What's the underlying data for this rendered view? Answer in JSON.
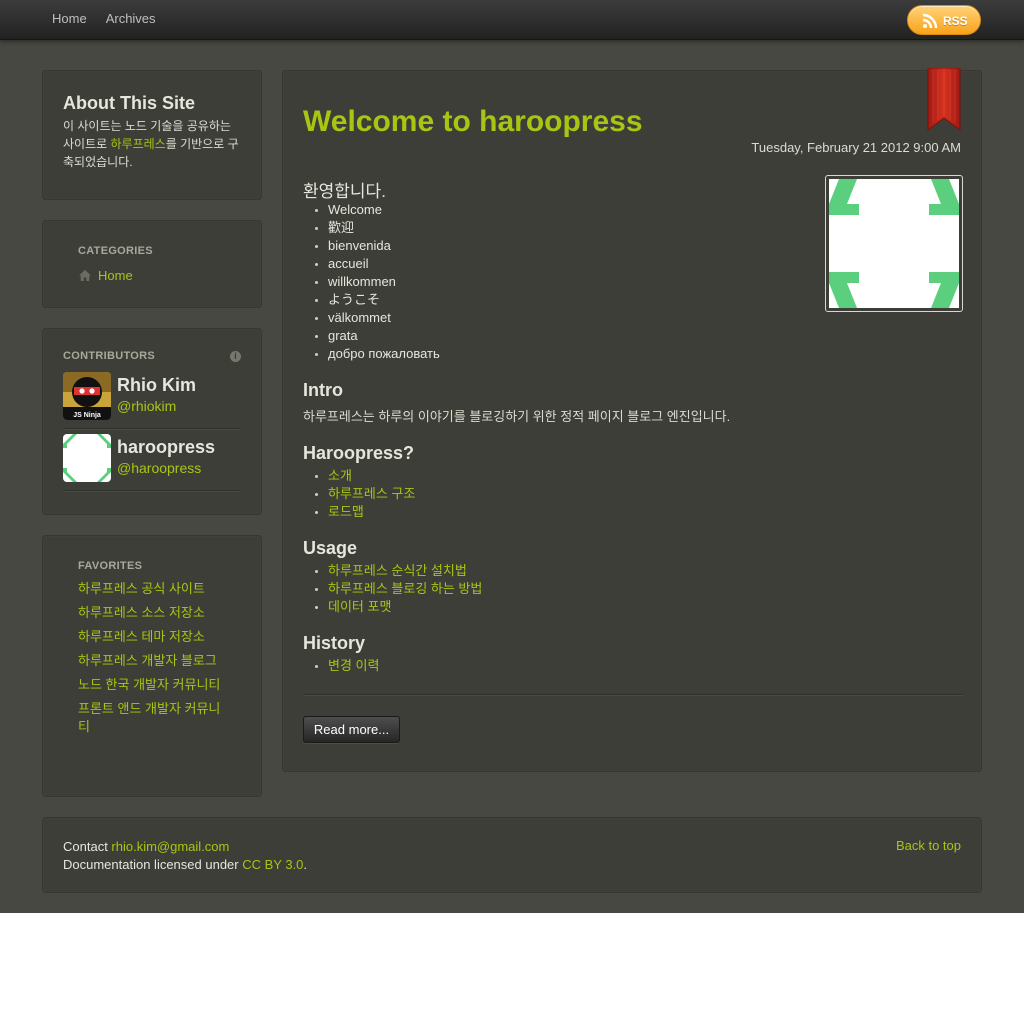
{
  "nav": {
    "home": "Home",
    "archives": "Archives",
    "rss": "RSS"
  },
  "about": {
    "title": "About This Site",
    "text_before": "이 사이트는 노드 기술을 공유하는 사이트로 ",
    "link": "하루프레스",
    "text_after": "를 기반으로 구축되었습니다."
  },
  "categories": {
    "title": "CATEGORIES",
    "items": [
      {
        "label": "Home",
        "icon": "home-icon"
      }
    ]
  },
  "contributors": {
    "title": "CONTRIBUTORS",
    "items": [
      {
        "name": "Rhio Kim",
        "handle": "@rhiokim",
        "avatar_caption": "JS Ninja"
      },
      {
        "name": "haroopress",
        "handle": "@haroopress"
      }
    ]
  },
  "favorites": {
    "title": "FAVORITES",
    "items": [
      "하루프레스 공식 사이트",
      "하루프레스 소스 저장소",
      "하루프레스 테마 저장소",
      "하루프레스 개발자 블로그",
      "노드 한국 개발자 커뮤니티",
      "프론트 앤드 개발자 커뮤니티"
    ]
  },
  "post": {
    "title": "Welcome to haroopress",
    "date": "Tuesday, February 21 2012 9:00 AM",
    "welcome_heading": "환영합니다.",
    "welcome_list": [
      "Welcome",
      "歡迎",
      "bienvenida",
      "accueil",
      "willkommen",
      "ようこそ",
      "välkommet",
      "grata",
      "добро пожаловать"
    ],
    "intro_heading": "Intro",
    "intro_text": "하루프레스는 하루의 이야기를 블로깅하기 위한 정적 페이지 블로그 엔진입니다.",
    "haroopress_heading": "Haroopress?",
    "haroopress_links": [
      "소개",
      "하루프레스 구조",
      "로드맵"
    ],
    "usage_heading": "Usage",
    "usage_links": [
      "하루프레스 순식간 설치법",
      "하루프레스 블로깅 하는 방법",
      "데이터 포맷"
    ],
    "history_heading": "History",
    "history_links": [
      "변경 이력"
    ],
    "read_more": "Read more..."
  },
  "footer": {
    "contact_label": "Contact ",
    "email": "rhio.kim@gmail.com",
    "license_label": "Documentation licensed under ",
    "license_link": "CC BY 3.0",
    "license_end": ".",
    "back_to_top": "Back to top"
  },
  "colors": {
    "accent": "#a9c514",
    "background": "#474841",
    "panel": "#3d3e37",
    "ribbon": "#c8281d",
    "logo_green": "#5ccf7e"
  }
}
